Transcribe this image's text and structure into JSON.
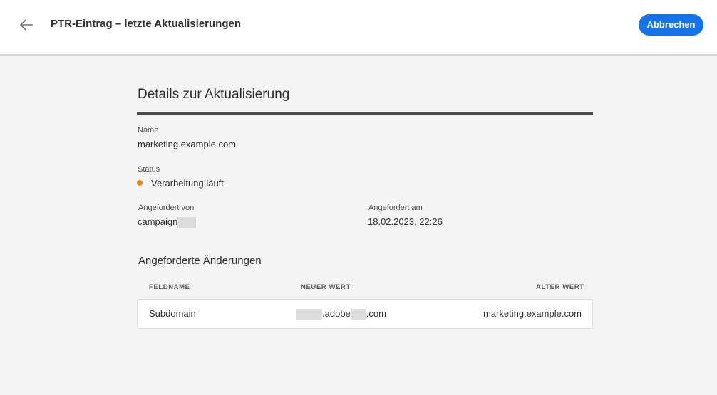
{
  "header": {
    "title": "PTR-Eintrag – letzte Aktualisierungen",
    "cancel_label": "Abbrechen"
  },
  "details": {
    "section_title": "Details zur Aktualisierung",
    "name_label": "Name",
    "name_value": "marketing.example.com",
    "status_label": "Status",
    "status_value": "Verarbeitung läuft",
    "status_color": "#e68619",
    "requested_by_label": "Angefordert von",
    "requested_by_value": "campaign",
    "requested_at_label": "Angefordert am",
    "requested_at_value": "18.02.2023, 22:26"
  },
  "changes": {
    "title": "Angeforderte Änderungen",
    "columns": [
      "FELDNAME",
      "NEUER WERT",
      "ALTER WERT"
    ],
    "rows": [
      {
        "field": "Subdomain",
        "new_value_middle": ".adobe",
        "new_value_end": ".com",
        "old_value": "marketing.example.com"
      }
    ]
  },
  "colors": {
    "accent": "#1473e6",
    "background": "#f4f4f4"
  }
}
